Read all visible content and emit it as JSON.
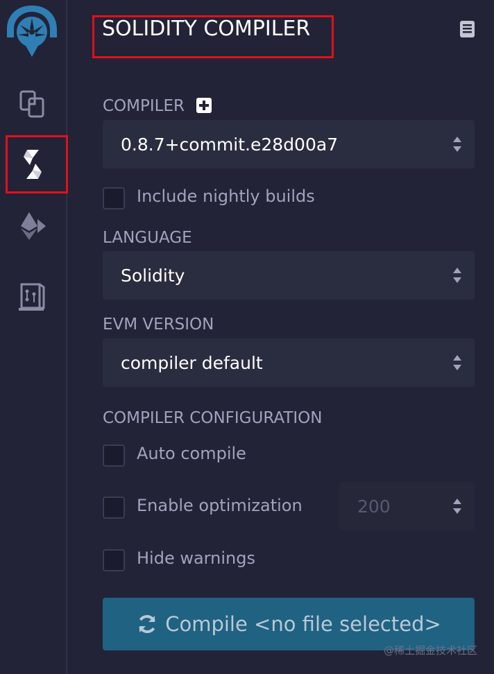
{
  "panel": {
    "title": "SOLIDITY COMPILER"
  },
  "compiler": {
    "label": "COMPILER",
    "selected_version": "0.8.7+commit.e28d00a7",
    "nightly_label": "Include nightly builds",
    "nightly_checked": false
  },
  "language": {
    "label": "LANGUAGE",
    "selected": "Solidity"
  },
  "evm": {
    "label": "EVM VERSION",
    "selected": "compiler default"
  },
  "config": {
    "label": "COMPILER CONFIGURATION",
    "auto_compile_label": "Auto compile",
    "auto_compile_checked": false,
    "optimization_label": "Enable optimization",
    "optimization_checked": false,
    "optimization_runs": "200",
    "hide_warnings_label": "Hide warnings",
    "hide_warnings_checked": false
  },
  "compile_button": {
    "label": "Compile <no file selected>"
  },
  "watermark": "@稀土掘金技术社区",
  "icons": {
    "logo": "remix-logo-icon",
    "file_explorer": "file-explorer-icon",
    "solidity": "solidity-compiler-icon",
    "deploy": "ethereum-deploy-icon",
    "plugin": "plugin-manager-icon",
    "docs": "documentation-icon",
    "refresh": "refresh-icon"
  },
  "colors": {
    "background": "#222336",
    "input_background": "#2a2c3f",
    "button_background": "#1f6282",
    "highlight_border": "#e0101e",
    "text_primary": "#ffffff",
    "text_muted": "#a2a3bd"
  }
}
